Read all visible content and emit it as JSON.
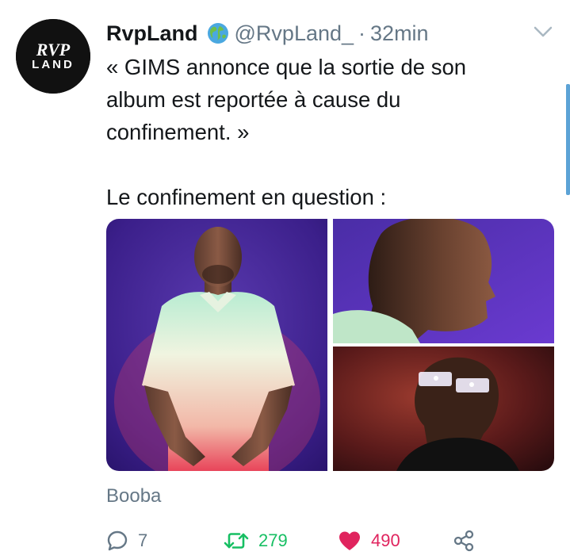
{
  "tweet": {
    "avatar": {
      "text_top": "RVP",
      "text_bottom": "LAND",
      "icon": "rvpland-logo"
    },
    "display_name": "RvpLand",
    "verified_badge_icon": "globe-icon",
    "handle": "@RvpLand_",
    "separator": "·",
    "timestamp": "32min",
    "menu_icon": "chevron-down-icon",
    "text_lines": [
      "« GIMS annonce que la sortie de son",
      "album est reportée à cause du",
      "confinement. »"
    ],
    "text_line_2": "Le confinement en question :",
    "media": [
      {
        "alt_icon": "photo-man-standing"
      },
      {
        "alt_icon": "photo-man-profile"
      },
      {
        "alt_icon": "photo-man-sunglasses"
      }
    ],
    "tagged_user": "Booba",
    "actions": {
      "reply": {
        "icon": "reply-icon",
        "count": "7"
      },
      "retweet": {
        "icon": "retweet-icon",
        "count": "279"
      },
      "like": {
        "icon": "heart-icon",
        "count": "490"
      },
      "share": {
        "icon": "share-icon"
      }
    },
    "colors": {
      "retweet": "#17bf63",
      "like": "#e0245e",
      "muted": "#657786"
    }
  }
}
